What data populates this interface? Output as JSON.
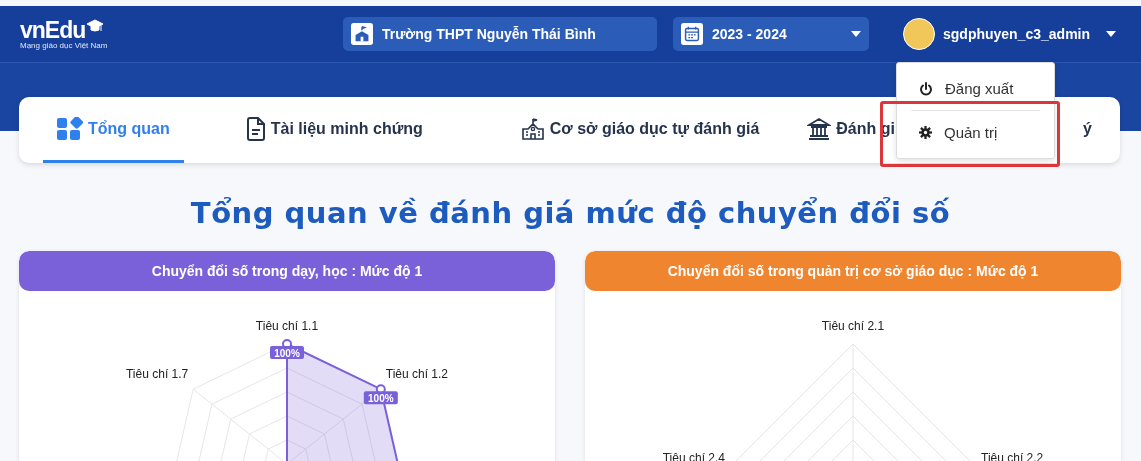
{
  "header": {
    "logo": {
      "text": "vnEdu",
      "tagline": "Mạng giáo dục Việt Nam"
    },
    "school": "Trường THPT Nguyễn Thái Bình",
    "school_year": "2023 - 2024",
    "user": "sgdphuyen_c3_admin"
  },
  "user_menu": {
    "expanded": true,
    "items": [
      {
        "label": "Đăng xuất",
        "kind": "logout",
        "highlighted": false
      },
      {
        "label": "Quản trị",
        "kind": "admin",
        "highlighted": true
      }
    ]
  },
  "tabs": [
    {
      "label": "Tổng quan",
      "kind": "overview",
      "selected": true
    },
    {
      "label": "Tài liệu minh chứng",
      "kind": "document",
      "selected": false
    },
    {
      "label": "Cơ sở giáo dục tự đánh giá",
      "kind": "school",
      "selected": false
    },
    {
      "label": "Đánh gi",
      "tail": "ý",
      "kind": "institution",
      "selected": false
    }
  ],
  "page_title": "Tổng quan về đánh giá mức độ chuyển đổi số",
  "panels": [
    {
      "title": "Chuyển đổi số trong dạy, học : Mức độ 1",
      "color": "#7b61d9",
      "has_data": true,
      "axes": [
        {
          "label": "Tiêu chí 1.1",
          "value_label": "100%"
        },
        {
          "label": "Tiêu chí 1.7"
        },
        {
          "label": "Tiêu chí 1.2",
          "value_label": "100%"
        }
      ]
    },
    {
      "title": "Chuyển đổi số trong quản trị cơ sở giáo dục : Mức độ 1",
      "color": "#f0852f",
      "has_data": false,
      "axes": [
        {
          "label": "Tiêu chí 2.1"
        },
        {
          "label": "Tiêu chí 2.4"
        },
        {
          "label": "Tiêu chí 2.2"
        }
      ]
    }
  ]
}
